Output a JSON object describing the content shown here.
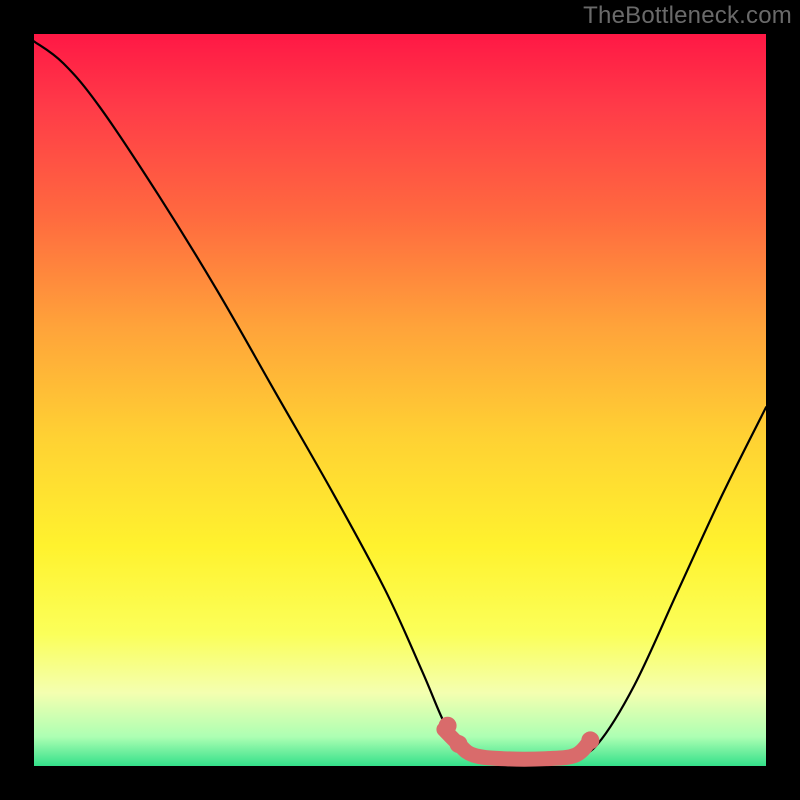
{
  "watermark": "TheBottleneck.com",
  "colors": {
    "curve": "#000000",
    "highlight": "#d96b6b",
    "background_black": "#000000"
  },
  "chart_data": {
    "type": "line",
    "title": "",
    "xlabel": "",
    "ylabel": "",
    "xlim": [
      0,
      100
    ],
    "ylim": [
      0,
      100
    ],
    "grid": false,
    "legend": false,
    "note": "Values are estimated from pixel positions; axes have no visible ticks. Higher y = higher bottleneck. The flat valley is the optimal region (highlighted).",
    "series": [
      {
        "name": "bottleneck-curve",
        "color": "#000000",
        "points": [
          {
            "x": 0,
            "y": 99
          },
          {
            "x": 4,
            "y": 96
          },
          {
            "x": 9,
            "y": 90
          },
          {
            "x": 17,
            "y": 78
          },
          {
            "x": 25,
            "y": 65
          },
          {
            "x": 33,
            "y": 51
          },
          {
            "x": 41,
            "y": 37
          },
          {
            "x": 48,
            "y": 24
          },
          {
            "x": 53,
            "y": 13
          },
          {
            "x": 56,
            "y": 6
          },
          {
            "x": 58,
            "y": 3
          },
          {
            "x": 60,
            "y": 1.5
          },
          {
            "x": 64,
            "y": 1
          },
          {
            "x": 70,
            "y": 1
          },
          {
            "x": 74,
            "y": 1.5
          },
          {
            "x": 77,
            "y": 3
          },
          {
            "x": 82,
            "y": 11
          },
          {
            "x": 88,
            "y": 24
          },
          {
            "x": 94,
            "y": 37
          },
          {
            "x": 100,
            "y": 49
          }
        ]
      },
      {
        "name": "optimal-region-highlight",
        "color": "#d96b6b",
        "points": [
          {
            "x": 56,
            "y": 5
          },
          {
            "x": 58,
            "y": 3
          },
          {
            "x": 60,
            "y": 1.5
          },
          {
            "x": 64,
            "y": 1
          },
          {
            "x": 70,
            "y": 1
          },
          {
            "x": 74,
            "y": 1.5
          },
          {
            "x": 76,
            "y": 3.5
          }
        ]
      }
    ],
    "highlight_markers": [
      {
        "x": 56.5,
        "y": 5.5
      },
      {
        "x": 58.0,
        "y": 3.0
      },
      {
        "x": 76.0,
        "y": 3.5
      }
    ]
  }
}
